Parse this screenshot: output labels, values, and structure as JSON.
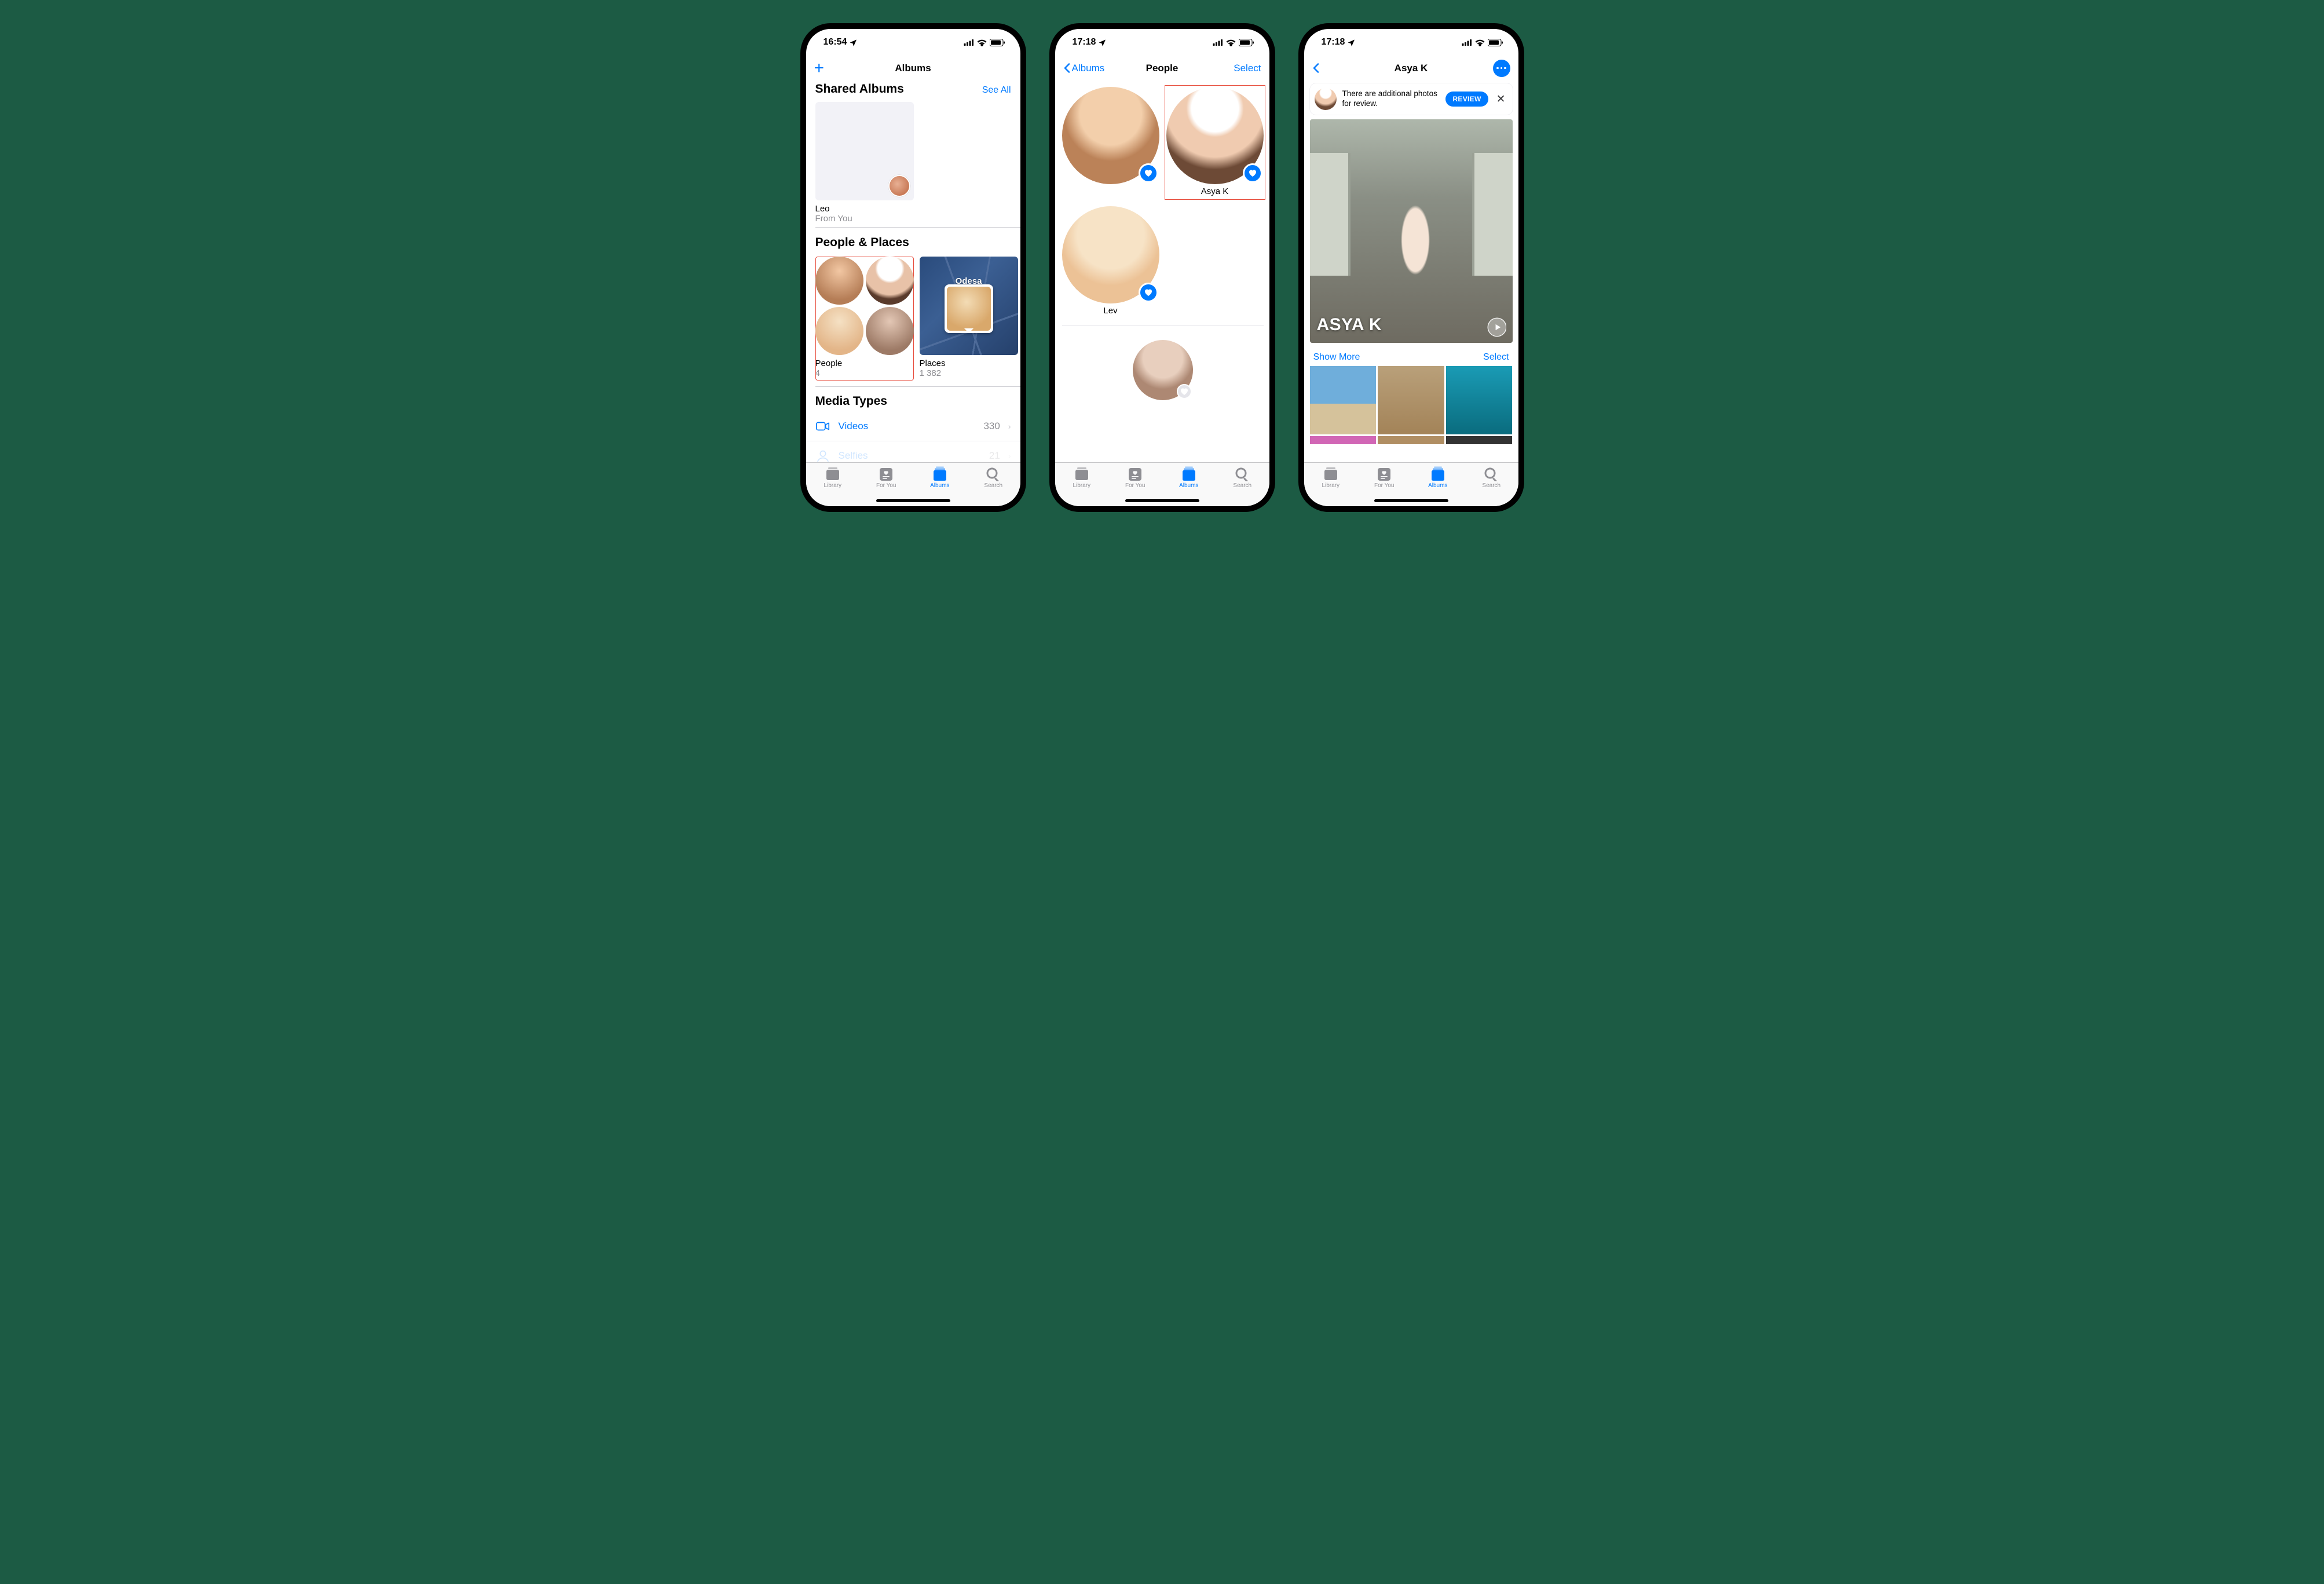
{
  "colors": {
    "tint": "#007aff",
    "highlight": "#e74c3c"
  },
  "status_icons": {
    "location": "location-arrow",
    "signal": "cellular-bars",
    "wifi": "wifi-icon",
    "battery": "battery-icon"
  },
  "tabs": {
    "library": "Library",
    "for_you": "For You",
    "albums": "Albums",
    "search": "Search",
    "active": "albums"
  },
  "phone1": {
    "status_time": "16:54",
    "nav": {
      "plus_icon": "plus-icon",
      "title": "Albums"
    },
    "shared": {
      "header": "Shared Albums",
      "see_all": "See All",
      "album": {
        "title": "Leo",
        "subtitle": "From You"
      }
    },
    "people_places": {
      "header": "People & Places",
      "people": {
        "title": "People",
        "count": "4"
      },
      "places": {
        "title": "Places",
        "count": "1 382",
        "city": "Odesa"
      }
    },
    "media_types": {
      "header": "Media Types",
      "items": [
        {
          "icon": "video-icon",
          "label": "Videos",
          "count": "330"
        },
        {
          "icon": "selfie-icon",
          "label": "Selfies",
          "count": "21"
        }
      ]
    }
  },
  "phone2": {
    "status_time": "17:18",
    "nav": {
      "back": "Albums",
      "title": "People",
      "select": "Select"
    },
    "people": [
      {
        "name": "",
        "favorite": true
      },
      {
        "name": "Asya K",
        "favorite": true,
        "highlighted": true
      },
      {
        "name": "Lev",
        "favorite": true
      },
      {
        "name": "",
        "favorite": false,
        "small": true
      }
    ]
  },
  "phone3": {
    "status_time": "17:18",
    "nav": {
      "back_icon": "chevron-left-icon",
      "title": "Asya K",
      "more_icon": "more-icon"
    },
    "banner": {
      "text": "There are additional photos for review.",
      "button": "REVIEW",
      "close_icon": "close-icon"
    },
    "hero": {
      "title": "ASYA K",
      "play_icon": "play-icon"
    },
    "row_actions": {
      "show_more": "Show More",
      "select": "Select"
    }
  }
}
